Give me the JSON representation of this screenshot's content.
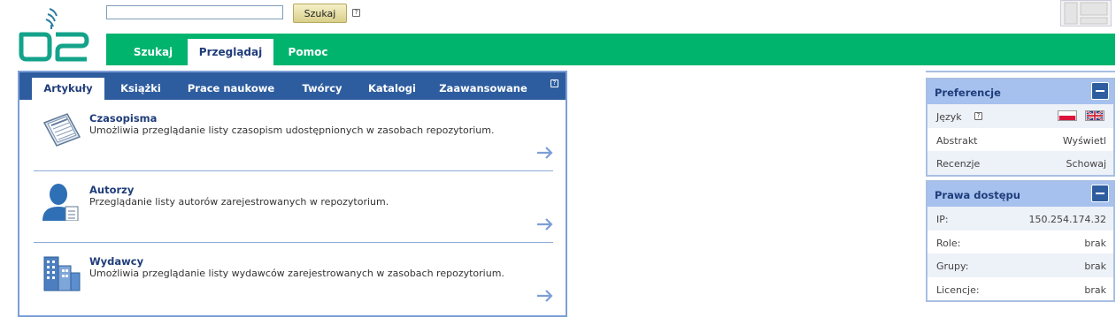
{
  "search": {
    "placeholder": "",
    "button_label": "Szukaj",
    "help": "?"
  },
  "nav": {
    "tabs": [
      {
        "label": "Szukaj",
        "active": false
      },
      {
        "label": "Przeglądaj",
        "active": true
      },
      {
        "label": "Pomoc",
        "active": false
      }
    ]
  },
  "browse": {
    "tabs": [
      {
        "label": "Artykuły",
        "active": true
      },
      {
        "label": "Książki",
        "active": false
      },
      {
        "label": "Prace naukowe",
        "active": false
      },
      {
        "label": "Twórcy",
        "active": false
      },
      {
        "label": "Katalogi",
        "active": false
      },
      {
        "label": "Zaawansowane",
        "active": false
      }
    ],
    "help": "?",
    "items": [
      {
        "title": "Czasopisma",
        "desc": "Umożliwia przeglądanie listy czasopism udostępnionych w zasobach repozytorium.",
        "icon": "journal-icon"
      },
      {
        "title": "Autorzy",
        "desc": "Przeglądanie listy autorów zarejestrowanych w repozytorium.",
        "icon": "author-icon"
      },
      {
        "title": "Wydawcy",
        "desc": "Umożliwia przeglądanie listy wydawców zarejestrowanych w zasobach repozytorium.",
        "icon": "publisher-icon"
      }
    ]
  },
  "preferences": {
    "title": "Preferencje",
    "language_label": "Język",
    "language_help": "?",
    "rows": [
      {
        "label": "Abstrakt",
        "value": "Wyświetl"
      },
      {
        "label": "Recenzje",
        "value": "Schowaj"
      }
    ]
  },
  "access": {
    "title": "Prawa dostępu",
    "rows": [
      {
        "label": "IP:",
        "value": "150.254.174.32"
      },
      {
        "label": "Role:",
        "value": "brak"
      },
      {
        "label": "Grupy:",
        "value": "brak"
      },
      {
        "label": "Licencje:",
        "value": "brak"
      }
    ]
  },
  "colors": {
    "nav_green": "#00b46e",
    "tab_blue": "#2e5d9f",
    "panel_header": "#a6c1ee",
    "title_navy": "#1f3d7a"
  }
}
